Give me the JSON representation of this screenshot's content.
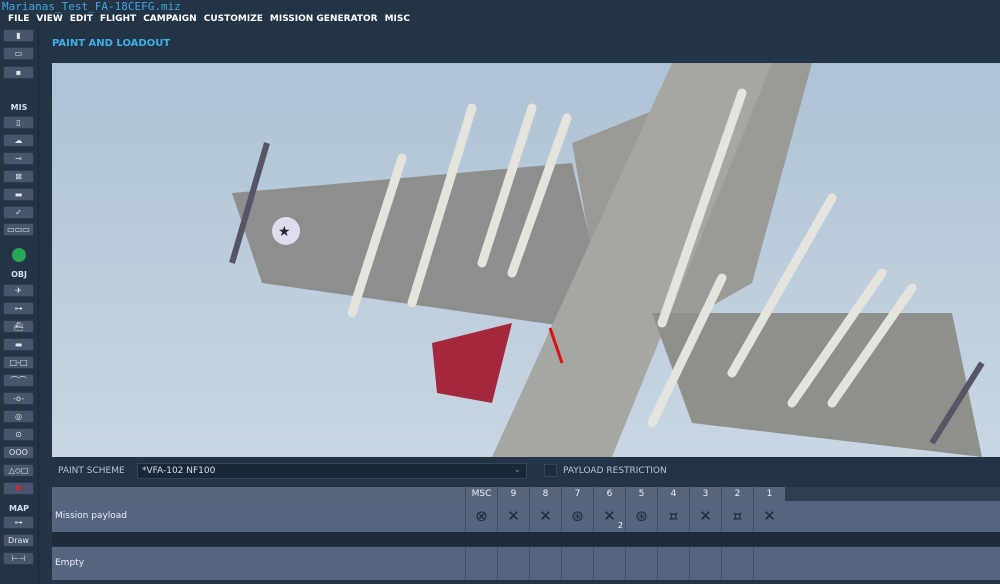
{
  "window": {
    "title": "Marianas_Test_FA-18CEFG.miz"
  },
  "menu": [
    "FILE",
    "VIEW",
    "EDIT",
    "FLIGHT",
    "CAMPAIGN",
    "CUSTOMIZE",
    "MISSION GENERATOR",
    "MISC"
  ],
  "sidebar": {
    "mis_label": "MIS",
    "obj_label": "OBJ",
    "map_label": "MAP",
    "draw_label": "Draw"
  },
  "panel": {
    "title": "PAINT AND LOADOUT"
  },
  "paint": {
    "label": "PAINT SCHEME",
    "value": "*VFA-102 NF100",
    "payload_restriction_label": "PAYLOAD RESTRICTION",
    "payload_restriction_checked": false
  },
  "loadout": {
    "columns": [
      "MSC",
      "9",
      "8",
      "7",
      "6",
      "5",
      "4",
      "3",
      "2",
      "1"
    ],
    "rows": [
      {
        "label": "Mission payload",
        "icons": [
          "⊗",
          "✕",
          "✕",
          "⊛",
          "✕",
          "⊛",
          "¤",
          "✕",
          "¤",
          "✕"
        ],
        "badge_col": "6",
        "badge": "2"
      },
      {
        "label": "Empty"
      }
    ]
  },
  "colors": {
    "accent": "#3fb0e6",
    "bg": "#243447"
  }
}
